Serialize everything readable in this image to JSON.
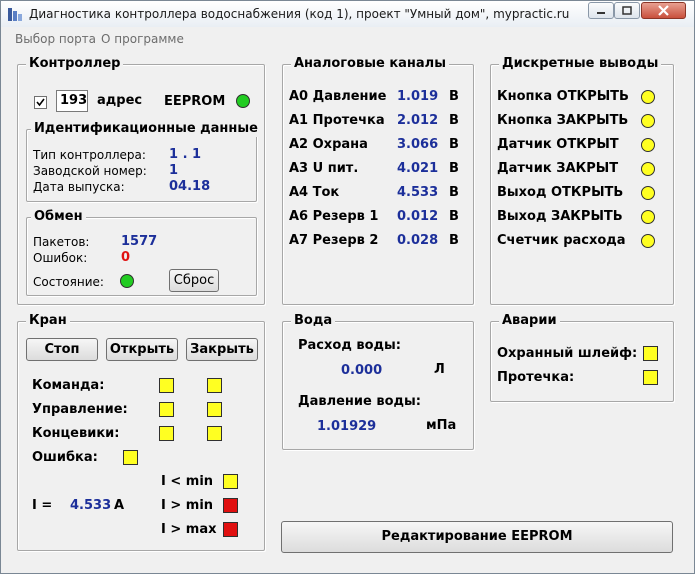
{
  "window": {
    "title": "Диагностика контроллера водоснабжения (код 1), проект \"Умный дом\", mypractic.ru"
  },
  "menu": {
    "items": [
      "Выбор порта",
      "О программе"
    ]
  },
  "controller": {
    "legend": "Контроллер",
    "address_value": "193",
    "address_label": "адрес",
    "eeprom_label": "EEPROM",
    "eeprom_led": "#22cc22",
    "ident": {
      "legend": "Идентификационные данные",
      "type_label": "Тип контроллера:",
      "type_value": "1 . 1",
      "serial_label": "Заводской номер:",
      "serial_value": "1",
      "date_label": "Дата выпуска:",
      "date_value": "04.18"
    },
    "exchange": {
      "legend": "Обмен",
      "packets_label": "Пакетов:",
      "packets_value": "1577",
      "errors_label": "Ошибок:",
      "errors_value": "0",
      "state_label": "Состояние:",
      "state_led": "#22cc22",
      "reset_label": "Сброс"
    }
  },
  "analog": {
    "legend": "Аналоговые каналы",
    "rows": [
      {
        "name": "A0 Давление",
        "value": "1.019",
        "unit": "В"
      },
      {
        "name": "A1 Протечка",
        "value": "2.012",
        "unit": "В"
      },
      {
        "name": "A2 Охрана",
        "value": "3.066",
        "unit": "В"
      },
      {
        "name": "A3 U пит.",
        "value": "4.021",
        "unit": "В"
      },
      {
        "name": "A4 Ток",
        "value": "4.533",
        "unit": "В"
      },
      {
        "name": "A6 Резерв 1",
        "value": "0.012",
        "unit": "В"
      },
      {
        "name": "A7 Резерв 2",
        "value": "0.028",
        "unit": "В"
      }
    ]
  },
  "discrete": {
    "legend": "Дискретные выводы",
    "rows": [
      "Кнопка ОТКРЫТЬ",
      "Кнопка ЗАКРЫТЬ",
      "Датчик ОТКРЫТ",
      "Датчик ЗАКРЫТ",
      "Выход ОТКРЫТЬ",
      "Выход ЗАКРЫТЬ",
      "Счетчик расхода"
    ],
    "led_color": "#ffff22"
  },
  "valve": {
    "legend": "Кран",
    "buttons": [
      "Стоп",
      "Открыть",
      "Закрыть"
    ],
    "status_rows": [
      "Команда:",
      "Управление:",
      "Концевики:"
    ],
    "error_label": "Ошибка:",
    "current_label": "I =",
    "current_value": "4.533",
    "current_unit": "А",
    "limits": [
      {
        "label": "I < min",
        "color": "#ffff22"
      },
      {
        "label": "I > min",
        "color": "#e01010"
      },
      {
        "label": "I > max",
        "color": "#e01010"
      }
    ],
    "indicator_color": "#ffff22"
  },
  "water": {
    "legend": "Вода",
    "flow_label": "Расход воды:",
    "flow_value": "0.000",
    "flow_unit": "Л",
    "pressure_label": "Давление воды:",
    "pressure_value": "1.01929",
    "pressure_unit": "мПа"
  },
  "alarms": {
    "legend": "Аварии",
    "rows": [
      {
        "label": "Охранный шлейф:",
        "color": "#ffff22"
      },
      {
        "label": "Протечка:",
        "color": "#ffff22"
      }
    ]
  },
  "eeprom_edit": {
    "label": "Редактирование EEPROM"
  }
}
